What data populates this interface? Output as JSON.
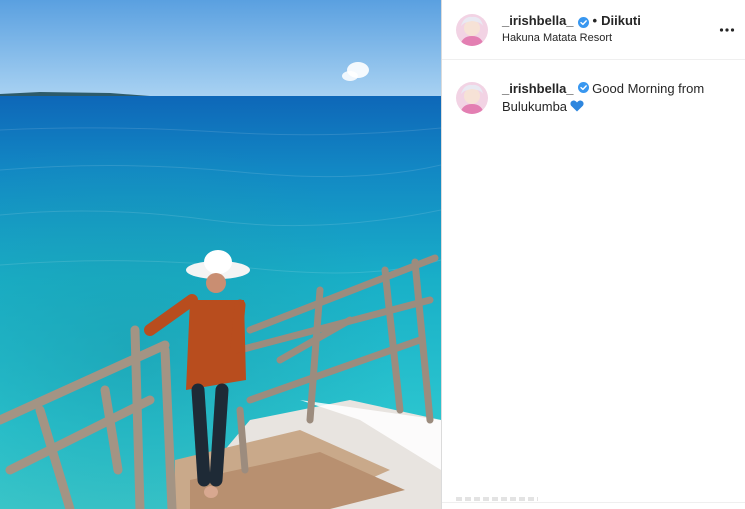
{
  "post": {
    "username": "_irishbella_",
    "verified": true,
    "follow_status": "Diikuti",
    "location": "Hakuna Matata Resort",
    "separator": "•"
  },
  "caption": {
    "username": "_irishbella_",
    "text": "Good Morning from Bulukumba",
    "emoji": "blue-heart"
  },
  "icons": {
    "verified": "verified-badge-icon",
    "more": "more-options-icon",
    "heart": "blue-heart-icon"
  },
  "colors": {
    "verified_blue": "#3897f0",
    "heart_blue": "#2e86de",
    "text": "#262626",
    "border": "#dbdbdb"
  }
}
